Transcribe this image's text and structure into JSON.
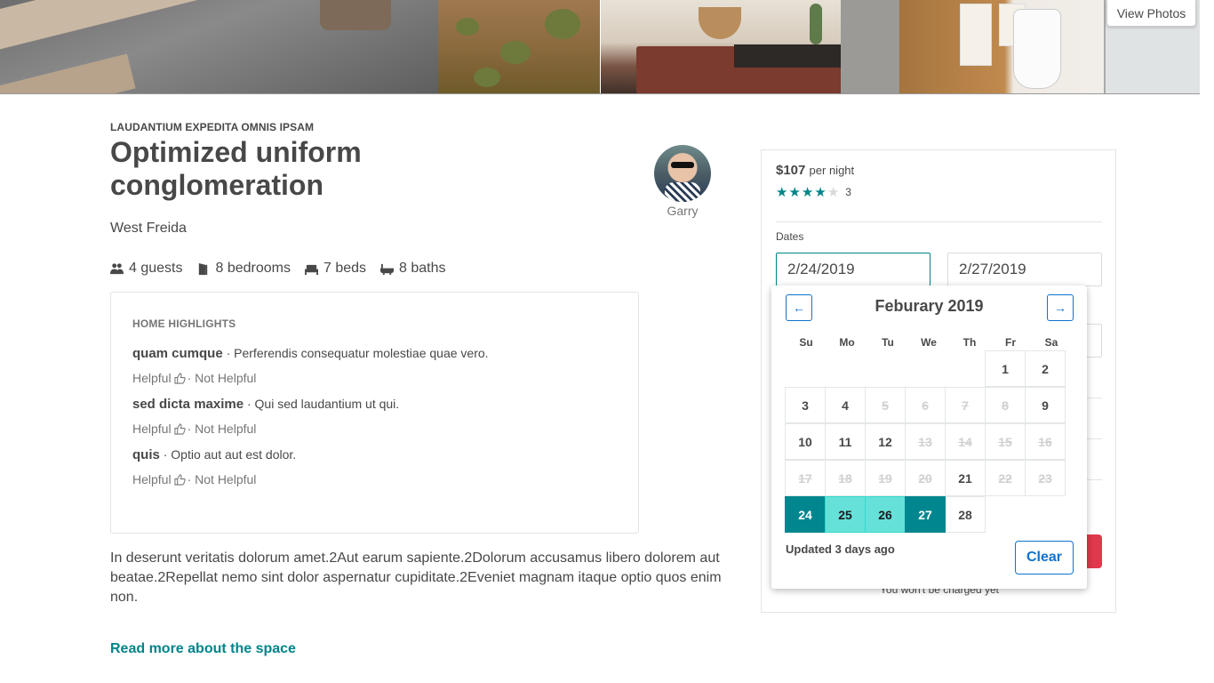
{
  "photos": {
    "view_photos_label": "View Photos"
  },
  "listing": {
    "eyebrow": "LAUDANTIUM EXPEDITA OMNIS IPSAM",
    "title": "Optimized uniform conglomeration",
    "location": "West Freida",
    "host_name": "Garry",
    "amenities": [
      {
        "icon": "guests-icon",
        "label": "4 guests"
      },
      {
        "icon": "bedrooms-icon",
        "label": "8 bedrooms"
      },
      {
        "icon": "beds-icon",
        "label": "7 beds"
      },
      {
        "icon": "baths-icon",
        "label": "8 baths"
      }
    ],
    "highlights": {
      "title": "HOME HIGHLIGHTS",
      "items": [
        {
          "name": "quam cumque",
          "text": "Perferendis consequatur molestiae quae vero."
        },
        {
          "name": "sed dicta maxime",
          "text": "Qui sed laudantium ut qui."
        },
        {
          "name": "quis",
          "text": "Optio aut aut est dolor."
        }
      ],
      "helpful_label": "Helpful",
      "not_helpful_label": "· Not Helpful"
    },
    "description": "In deserunt veritatis dolorum amet.2Aut earum sapiente.2Dolorum accusamus libero dolorem aut beatae.2Repellat nemo sint dolor aspernatur cupiditate.2Eveniet magnam itaque optio quos enim non.",
    "read_more_label": "Read more about the space"
  },
  "booking": {
    "price": "$107",
    "per_night": "per night",
    "rating": 4,
    "rating_max": 5,
    "review_count": "3",
    "dates_label": "Dates",
    "check_in": "2/24/2019",
    "check_out": "2/27/2019",
    "charged_note": "You won't be charged yet"
  },
  "calendar": {
    "month_label": "Feburary 2019",
    "prev_label": "←",
    "next_label": "→",
    "dow": [
      "Su",
      "Mo",
      "Tu",
      "We",
      "Th",
      "Fr",
      "Sa"
    ],
    "weeks": [
      [
        null,
        null,
        null,
        null,
        null,
        {
          "d": "1",
          "s": "open"
        },
        {
          "d": "2",
          "s": "open"
        }
      ],
      [
        {
          "d": "3",
          "s": "open"
        },
        {
          "d": "4",
          "s": "open"
        },
        {
          "d": "5",
          "s": "blocked"
        },
        {
          "d": "6",
          "s": "blocked"
        },
        {
          "d": "7",
          "s": "blocked"
        },
        {
          "d": "8",
          "s": "blocked"
        },
        {
          "d": "9",
          "s": "open"
        }
      ],
      [
        {
          "d": "10",
          "s": "open"
        },
        {
          "d": "11",
          "s": "open"
        },
        {
          "d": "12",
          "s": "open"
        },
        {
          "d": "13",
          "s": "blocked"
        },
        {
          "d": "14",
          "s": "blocked"
        },
        {
          "d": "15",
          "s": "blocked"
        },
        {
          "d": "16",
          "s": "blocked"
        }
      ],
      [
        {
          "d": "17",
          "s": "blocked"
        },
        {
          "d": "18",
          "s": "blocked"
        },
        {
          "d": "19",
          "s": "blocked"
        },
        {
          "d": "20",
          "s": "blocked"
        },
        {
          "d": "21",
          "s": "open"
        },
        {
          "d": "22",
          "s": "blocked"
        },
        {
          "d": "23",
          "s": "blocked"
        }
      ],
      [
        {
          "d": "24",
          "s": "selected"
        },
        {
          "d": "25",
          "s": "span"
        },
        {
          "d": "26",
          "s": "span"
        },
        {
          "d": "27",
          "s": "selected"
        },
        {
          "d": "28",
          "s": "open"
        },
        null,
        null
      ]
    ],
    "updated_label": "Updated 3 days ago",
    "clear_label": "Clear"
  },
  "colors": {
    "accent_teal": "#008489",
    "selected_day": "#00868f",
    "span_day": "#66e1d9",
    "link_blue": "#0f73ce",
    "book_red": "#e0384c"
  }
}
